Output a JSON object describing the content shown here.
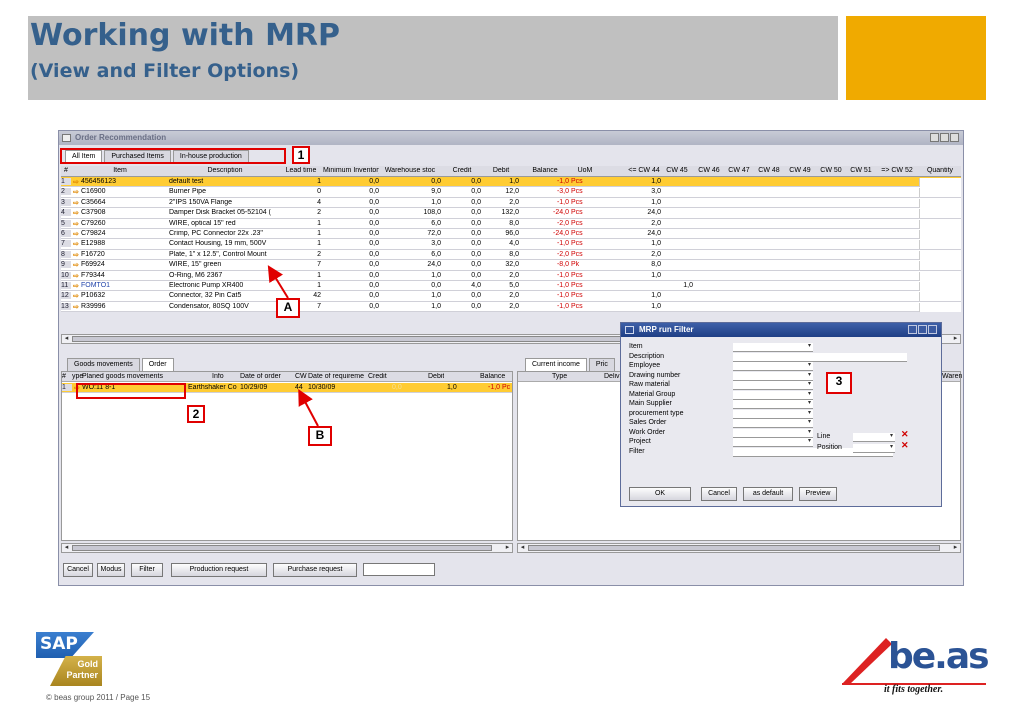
{
  "slide": {
    "title": "Working with MRP",
    "subtitle": "(View and Filter Options)",
    "copyright": "© beas group 2011 / Page 15",
    "sap_logo_text": "SAP",
    "sap_badge_line1": "Gold",
    "sap_badge_line2": "Partner",
    "beas_logo_text": "be.as",
    "beas_tagline": "it fits together."
  },
  "window": {
    "title": "Order Recommendation",
    "tabs": [
      "All Item",
      "Purchased Items",
      "In-house production"
    ],
    "columns": [
      "#",
      "Item",
      "Description",
      "Lead time",
      "Minimum Inventory",
      "Warehouse stoc",
      "Credit",
      "Debit",
      "Balance",
      "UoM",
      "<= CW 44",
      "CW 45",
      "CW 46",
      "CW 47",
      "CW 48",
      "CW 49",
      "CW 50",
      "CW 51",
      "=> CW 52",
      "Quantity"
    ],
    "rows": [
      {
        "n": "1",
        "item": "456456123",
        "desc": "default test",
        "lead": "1",
        "min": "0,0",
        "wh": "0,0",
        "credit": "0,0",
        "debit": "1,0",
        "bal": "-1,0",
        "uom": "Pcs",
        "cw44": "1,0",
        "cw45": ""
      },
      {
        "n": "2",
        "item": "C16900",
        "desc": "Burner Pipe",
        "lead": "0",
        "min": "0,0",
        "wh": "9,0",
        "credit": "0,0",
        "debit": "12,0",
        "bal": "-3,0",
        "uom": "Pcs",
        "cw44": "3,0",
        "cw45": ""
      },
      {
        "n": "3",
        "item": "C35664",
        "desc": "2\"IPS 150VA Flange",
        "lead": "4",
        "min": "0,0",
        "wh": "1,0",
        "credit": "0,0",
        "debit": "2,0",
        "bal": "-1,0",
        "uom": "Pcs",
        "cw44": "1,0",
        "cw45": ""
      },
      {
        "n": "4",
        "item": "C37908",
        "desc": "Damper Disk Bracket 05-52104 (",
        "lead": "2",
        "min": "0,0",
        "wh": "108,0",
        "credit": "0,0",
        "debit": "132,0",
        "bal": "-24,0",
        "uom": "Pcs",
        "cw44": "24,0",
        "cw45": ""
      },
      {
        "n": "5",
        "item": "C79260",
        "desc": "WIRE, optical 15\" red",
        "lead": "1",
        "min": "0,0",
        "wh": "6,0",
        "credit": "0,0",
        "debit": "8,0",
        "bal": "-2,0",
        "uom": "Pcs",
        "cw44": "2,0",
        "cw45": ""
      },
      {
        "n": "6",
        "item": "C79824",
        "desc": "Crimp, PC Connector 22x .23\"",
        "lead": "1",
        "min": "0,0",
        "wh": "72,0",
        "credit": "0,0",
        "debit": "96,0",
        "bal": "-24,0",
        "uom": "Pcs",
        "cw44": "24,0",
        "cw45": ""
      },
      {
        "n": "7",
        "item": "E12988",
        "desc": "Contact Housing, 19 mm, 500V",
        "lead": "1",
        "min": "0,0",
        "wh": "3,0",
        "credit": "0,0",
        "debit": "4,0",
        "bal": "-1,0",
        "uom": "Pcs",
        "cw44": "1,0",
        "cw45": ""
      },
      {
        "n": "8",
        "item": "F16720",
        "desc": "Plate, 1\" x 12.5\", Control Mount",
        "lead": "2",
        "min": "0,0",
        "wh": "6,0",
        "credit": "0,0",
        "debit": "8,0",
        "bal": "-2,0",
        "uom": "Pcs",
        "cw44": "2,0",
        "cw45": ""
      },
      {
        "n": "9",
        "item": "F69924",
        "desc": "WIRE, 15\" green",
        "lead": "7",
        "min": "0,0",
        "wh": "24,0",
        "credit": "0,0",
        "debit": "32,0",
        "bal": "-8,0",
        "uom": "Pk",
        "cw44": "8,0",
        "cw45": ""
      },
      {
        "n": "10",
        "item": "F79344",
        "desc": "O-Ring, M6 2367",
        "lead": "1",
        "min": "0,0",
        "wh": "1,0",
        "credit": "0,0",
        "debit": "2,0",
        "bal": "-1,0",
        "uom": "Pcs",
        "cw44": "1,0",
        "cw45": ""
      },
      {
        "n": "11",
        "item": "FOMTO1",
        "desc": "Electronic Pump XR400",
        "lead": "1",
        "min": "0,0",
        "wh": "0,0",
        "credit": "4,0",
        "debit": "5,0",
        "bal": "-1,0",
        "uom": "Pcs",
        "cw44": "",
        "cw45": "1,0"
      },
      {
        "n": "12",
        "item": "P10632",
        "desc": "Connector, 32 Pin Cat5",
        "lead": "42",
        "min": "0,0",
        "wh": "1,0",
        "credit": "0,0",
        "debit": "2,0",
        "bal": "-1,0",
        "uom": "Pcs",
        "cw44": "1,0",
        "cw45": ""
      },
      {
        "n": "13",
        "item": "R39996",
        "desc": "Condensator, 80SQ 100V",
        "lead": "7",
        "min": "0,0",
        "wh": "1,0",
        "credit": "0,0",
        "debit": "2,0",
        "bal": "-1,0",
        "uom": "Pcs",
        "cw44": "1,0",
        "cw45": ""
      }
    ],
    "lower_tabs": [
      "Goods movements",
      "Order"
    ],
    "lower_columns": [
      "#",
      "ype",
      "Planed goods movements",
      "Info",
      "Date of order",
      "CW",
      "Date of requireme",
      "Credit",
      "Debit",
      "Balance"
    ],
    "lower_row": {
      "n": "1",
      "ref": "WO:11 8-1",
      "info": "Earthshaker Co",
      "date_order": "10/29/09",
      "cw": "44",
      "date_req": "10/30/09",
      "credit": "0,0",
      "debit": "1,0",
      "bal": "-1,0",
      "uom": "Pc"
    },
    "right_tabs": [
      "Current income",
      "Pric"
    ],
    "right_columns": [
      "Type",
      "Deliv",
      "Waren"
    ],
    "buttons": [
      "Cancel",
      "Modus",
      "Filter",
      "Production request",
      "Purchase request"
    ]
  },
  "callouts": [
    "1",
    "2",
    "3",
    "A",
    "B"
  ],
  "filter_dialog": {
    "title": "MRP run Filter",
    "fields": [
      "Item",
      "Description",
      "Employee",
      "Drawing number",
      "Raw material",
      "Material Group",
      "Main Supplier",
      "procurement type",
      "Sales Order",
      "Work Order",
      "Project",
      "Filter"
    ],
    "line_label": "Line",
    "position_label": "Position",
    "buttons": [
      "OK",
      "Cancel",
      "as default",
      "Preview"
    ]
  }
}
